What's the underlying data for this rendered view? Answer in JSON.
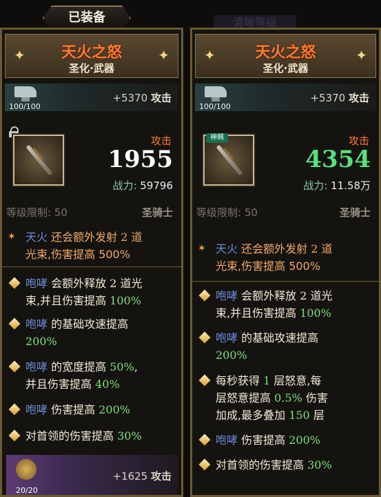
{
  "header_tab": "已装备",
  "background_text": "清晰等级",
  "left": {
    "name": "天火之怒",
    "subtitle": "圣化·武器",
    "enhance_count": "100/100",
    "enhance_bonus_value": "+5370",
    "enhance_bonus_label": "攻击",
    "attack_label": "攻击",
    "attack_value": "1955",
    "power_label": "战力:",
    "power_value": "59796",
    "level_label": "等级限制:",
    "level_value": "50",
    "class": "圣骑士",
    "star_effect": {
      "kw": "天火",
      "text1": "还会额外发射",
      "num": "2",
      "text2": "道",
      "text3": "光束,伤害提高",
      "pct": "500%"
    },
    "effects": [
      {
        "kw": "咆哮",
        "text": "会额外释放",
        "num": "2",
        "text2": "道光",
        "text3": "束,并且伤害提高",
        "pct": "100%"
      },
      {
        "kw": "咆哮",
        "text": "的基础攻速提高",
        "pct": "200%"
      },
      {
        "kw": "咆哮",
        "text": "的宽度提高",
        "pct": "50%",
        "text2": ",",
        "text3": "并且伤害提高",
        "pct2": "40%"
      },
      {
        "kw": "咆哮",
        "text": "伤害提高",
        "pct": "200%"
      },
      {
        "text": "对首领的伤害提高",
        "pct": "30%"
      }
    ],
    "purple_count": "20/20",
    "purple_bonus_value": "+1625",
    "purple_bonus_label": "攻击"
  },
  "right": {
    "name": "天火之怒",
    "subtitle": "圣化·武器",
    "enhance_count": "100/100",
    "enhance_bonus_value": "+5370",
    "enhance_bonus_label": "攻击",
    "badge": "神赐",
    "attack_label": "攻击",
    "attack_value": "4354",
    "power_label": "战力:",
    "power_value": "11.58万",
    "level_label": "等级限制:",
    "level_value": "50",
    "class": "圣骑士",
    "star_effect": {
      "kw": "天火",
      "text1": "还会额外发射",
      "num": "2",
      "text2": "道",
      "text3": "光束,伤害提高",
      "pct": "500%"
    },
    "effects": [
      {
        "kw": "咆哮",
        "text": "会额外释放",
        "num": "2",
        "text2": "道光",
        "text3": "束,并且伤害提高",
        "pct": "100%"
      },
      {
        "kw": "咆哮",
        "text": "的基础攻速提高",
        "pct": "200%"
      },
      {
        "text": "每秒获得",
        "num": "1",
        "text2": "层怒意,每",
        "text3": "层怒意提高",
        "pct": "0.5%",
        "text4": "伤害",
        "text5": "加成,最多叠加",
        "num2": "150",
        "text6": "层"
      },
      {
        "kw": "咆哮",
        "text": "伤害提高",
        "pct": "200%"
      },
      {
        "text": "对首领的伤害提高",
        "pct": "30%"
      }
    ]
  }
}
